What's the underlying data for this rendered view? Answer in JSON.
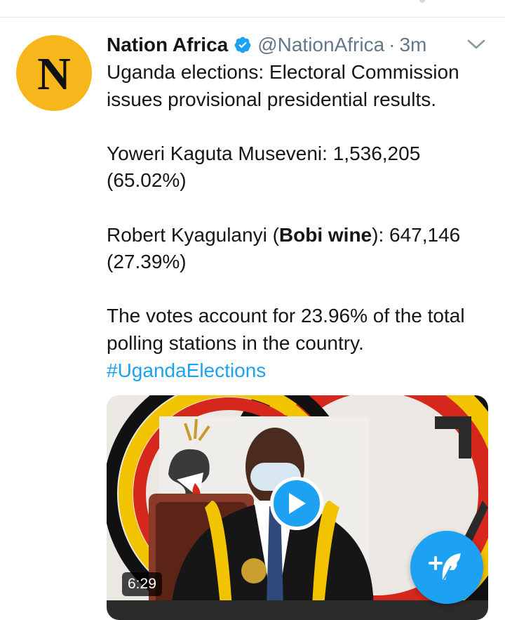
{
  "colors": {
    "accent": "#1da1f2",
    "avatar_bg": "#f7b71c",
    "text": "#14171a",
    "muted": "#657786"
  },
  "tweet": {
    "avatar_letter": "N",
    "author_name": "Nation Africa",
    "handle": "@NationAfrica",
    "separator": "·",
    "time": "3m",
    "text": {
      "line1": "Uganda elections: Electoral Commission issues provisional presidential results.",
      "candidate1": "Yoweri Kaguta Museveni: 1,536,205 (65.02%)",
      "candidate2_name": "Robert Kyagulanyi (",
      "candidate2_alias": "Bobi wine",
      "candidate2_rest": "): 647,146 (27.39%)",
      "summary": "The votes  account for 23.96% of the total polling stations in the country.",
      "hashtag": "#UgandaElections"
    },
    "media": {
      "duration": "6:29",
      "play_icon": "play-icon"
    }
  },
  "icons": {
    "verified": "verified-badge-icon",
    "more": "chevron-down-icon",
    "compose": "compose-feather-icon"
  }
}
